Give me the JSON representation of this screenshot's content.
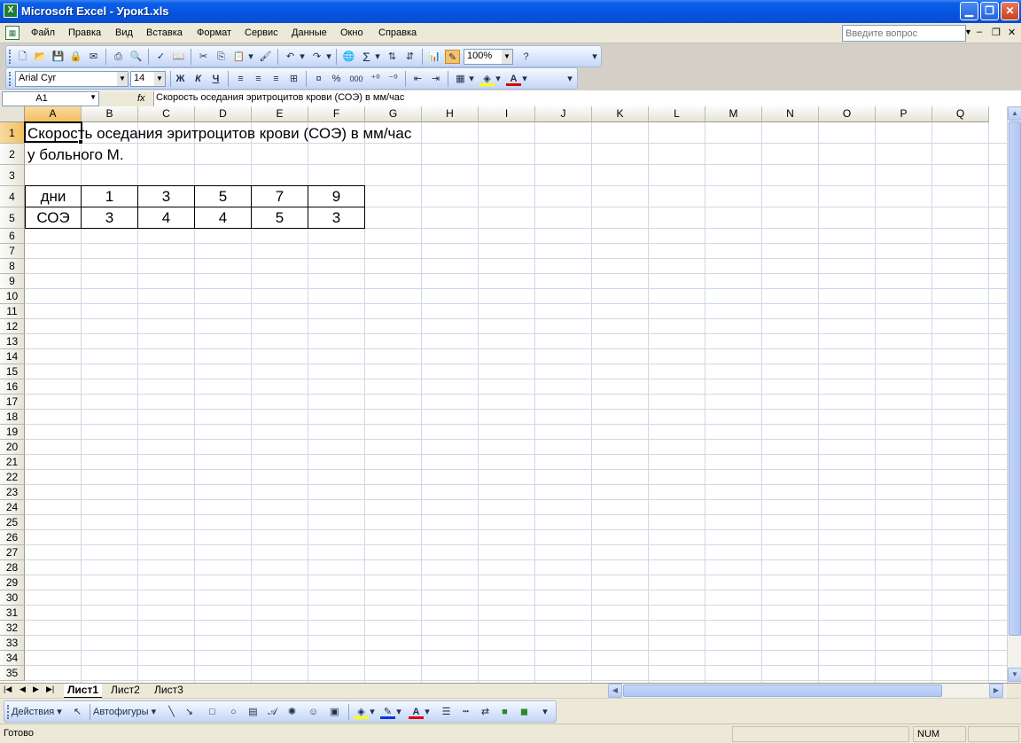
{
  "window": {
    "title": "Microsoft Excel - Урок1.xls",
    "minimize_icon": "minimize-icon",
    "restore_icon": "restore-icon",
    "close_icon": "close-icon"
  },
  "menu": {
    "items": [
      "Файл",
      "Правка",
      "Вид",
      "Вставка",
      "Формат",
      "Сервис",
      "Данные",
      "Окно",
      "Справка"
    ],
    "ask_placeholder": "Введите вопрос"
  },
  "toolbar": {
    "zoom": "100%",
    "font_name": "Arial Cyr",
    "font_size": "14",
    "bold_label": "Ж",
    "italic_label": "К",
    "underline_label": "Ч",
    "percent_label": "%",
    "thousands_label": "000",
    "autosum_label": "Σ"
  },
  "formula_bar": {
    "name_box": "A1",
    "fx_label": "fx",
    "formula": "Скорость оседания эритроцитов крови (СОЭ) в мм/час"
  },
  "sheet": {
    "columns": [
      "A",
      "B",
      "C",
      "D",
      "E",
      "F",
      "G",
      "H",
      "I",
      "J",
      "K",
      "L",
      "M",
      "N",
      "O",
      "P",
      "Q"
    ],
    "rows": [
      "1",
      "2",
      "3",
      "4",
      "5",
      "6",
      "7",
      "8",
      "9",
      "10",
      "11",
      "12",
      "13",
      "14",
      "15",
      "16",
      "17",
      "18",
      "19",
      "20",
      "21",
      "22",
      "23",
      "24",
      "25",
      "26",
      "27",
      "28",
      "29",
      "30",
      "31",
      "32",
      "33",
      "34",
      "35"
    ],
    "selected_cell": "A1",
    "a1": "Скорость оседания эритроцитов крови (СОЭ) в мм/час",
    "a2": "у больного М.",
    "table": {
      "row4": [
        "дни",
        "1",
        "3",
        "5",
        "7",
        "9"
      ],
      "row5": [
        "СОЭ",
        "3",
        "4",
        "4",
        "5",
        "3"
      ]
    }
  },
  "tabs": [
    "Лист1",
    "Лист2",
    "Лист3"
  ],
  "active_tab": "Лист1",
  "drawing": {
    "actions": "Действия",
    "autoshapes": "Автофигуры"
  },
  "status": {
    "text": "Готово",
    "num": "NUM"
  }
}
